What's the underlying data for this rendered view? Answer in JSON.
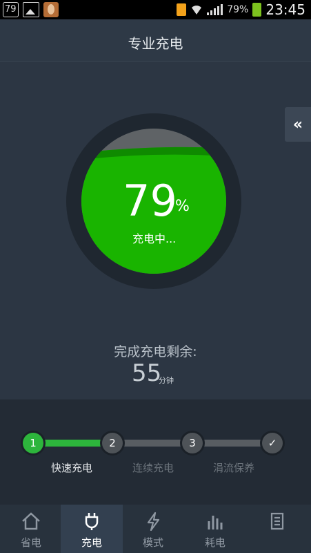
{
  "status_bar": {
    "badge": "79",
    "battery_percent": "79%",
    "time": "23:45",
    "icons": [
      "image-icon",
      "app-egg-icon",
      "file-icon",
      "wifi-icon",
      "signal-icon",
      "battery-charging-icon"
    ]
  },
  "header": {
    "title": "专业充电"
  },
  "side_toggle": {
    "label": "«"
  },
  "gauge": {
    "percent": "79",
    "percent_symbol": "%",
    "level": 0.79,
    "status": "充电中...",
    "colors": {
      "fill": "#19b400",
      "ring": "#1f2730",
      "empty": "#5f6366"
    }
  },
  "remaining": {
    "label": "完成充电剩余:",
    "value": "55",
    "unit": "分钟"
  },
  "stepper": {
    "progress": 0.33,
    "steps": [
      {
        "number": "1",
        "label": "快速充电"
      },
      {
        "number": "2",
        "label": "连续充电"
      },
      {
        "number": "3",
        "label": "涓流保养"
      },
      {
        "number": "✓",
        "label": ""
      }
    ],
    "active_color": "#2db53c"
  },
  "tabs": [
    {
      "label": "省电",
      "icon": "home-icon"
    },
    {
      "label": "充电",
      "icon": "plug-icon"
    },
    {
      "label": "模式",
      "icon": "lightning-icon"
    },
    {
      "label": "耗电",
      "icon": "bar-chart-icon"
    },
    {
      "label": "",
      "icon": "document-icon"
    }
  ]
}
